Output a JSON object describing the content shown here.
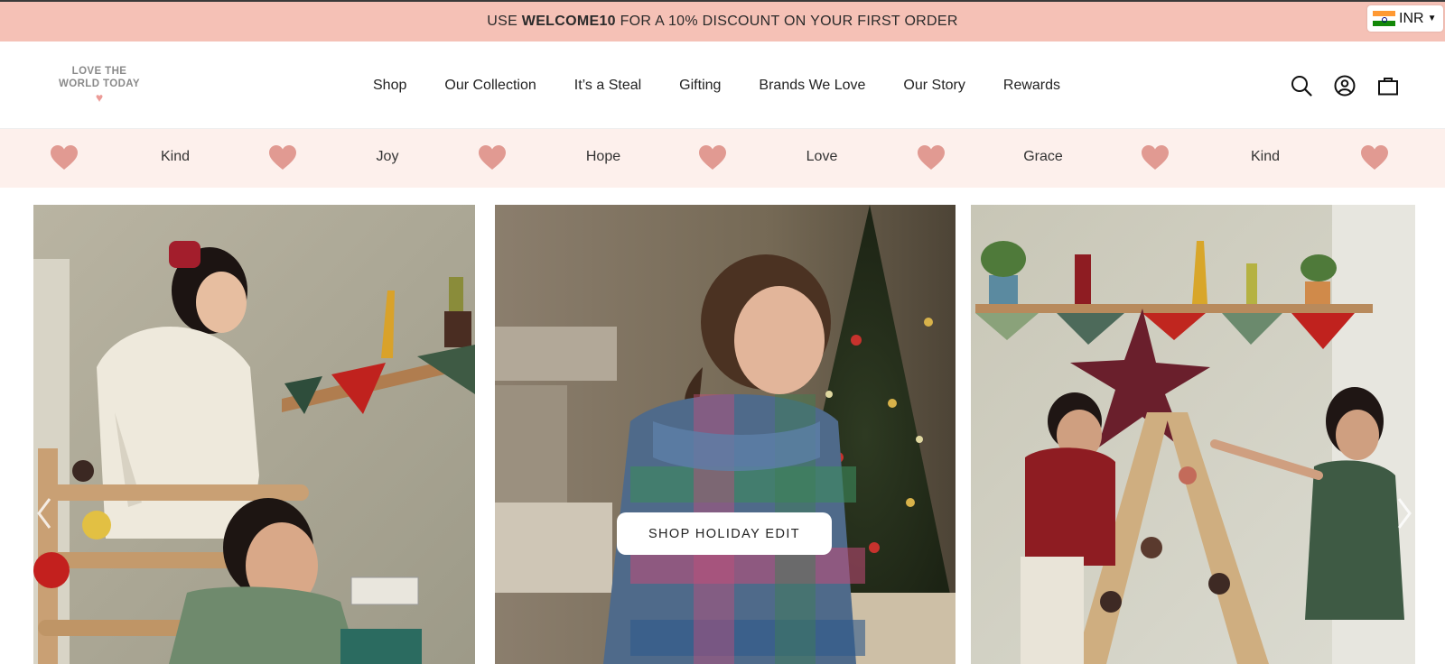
{
  "announcement": {
    "prefix": "USE ",
    "code": "WELCOME10",
    "suffix": " FOR A 10% DISCOUNT ON YOUR FIRST ORDER"
  },
  "currency": {
    "label": "INR",
    "flag_icon": "india-flag-icon"
  },
  "logo": {
    "line1": "LOVE THE",
    "line2": "WORLD TODAY",
    "heart": "♥"
  },
  "nav": {
    "items": [
      {
        "label": "Shop"
      },
      {
        "label": "Our Collection"
      },
      {
        "label": "It’s a Steal"
      },
      {
        "label": "Gifting"
      },
      {
        "label": "Brands We Love"
      },
      {
        "label": "Our Story"
      },
      {
        "label": "Rewards"
      }
    ]
  },
  "header_icons": [
    "search-icon",
    "account-icon",
    "bag-icon"
  ],
  "values_strip": {
    "words": [
      "Kind",
      "Joy",
      "Hope",
      "Love",
      "Grace",
      "Kind"
    ],
    "heart_color": "#e19a92"
  },
  "hero": {
    "cta_label": "SHOP HOLIDAY EDIT"
  },
  "colors": {
    "announcement_bg": "#f5c1b6",
    "strip_bg": "#fdf0ec",
    "logo_heart": "#ec9b97"
  }
}
